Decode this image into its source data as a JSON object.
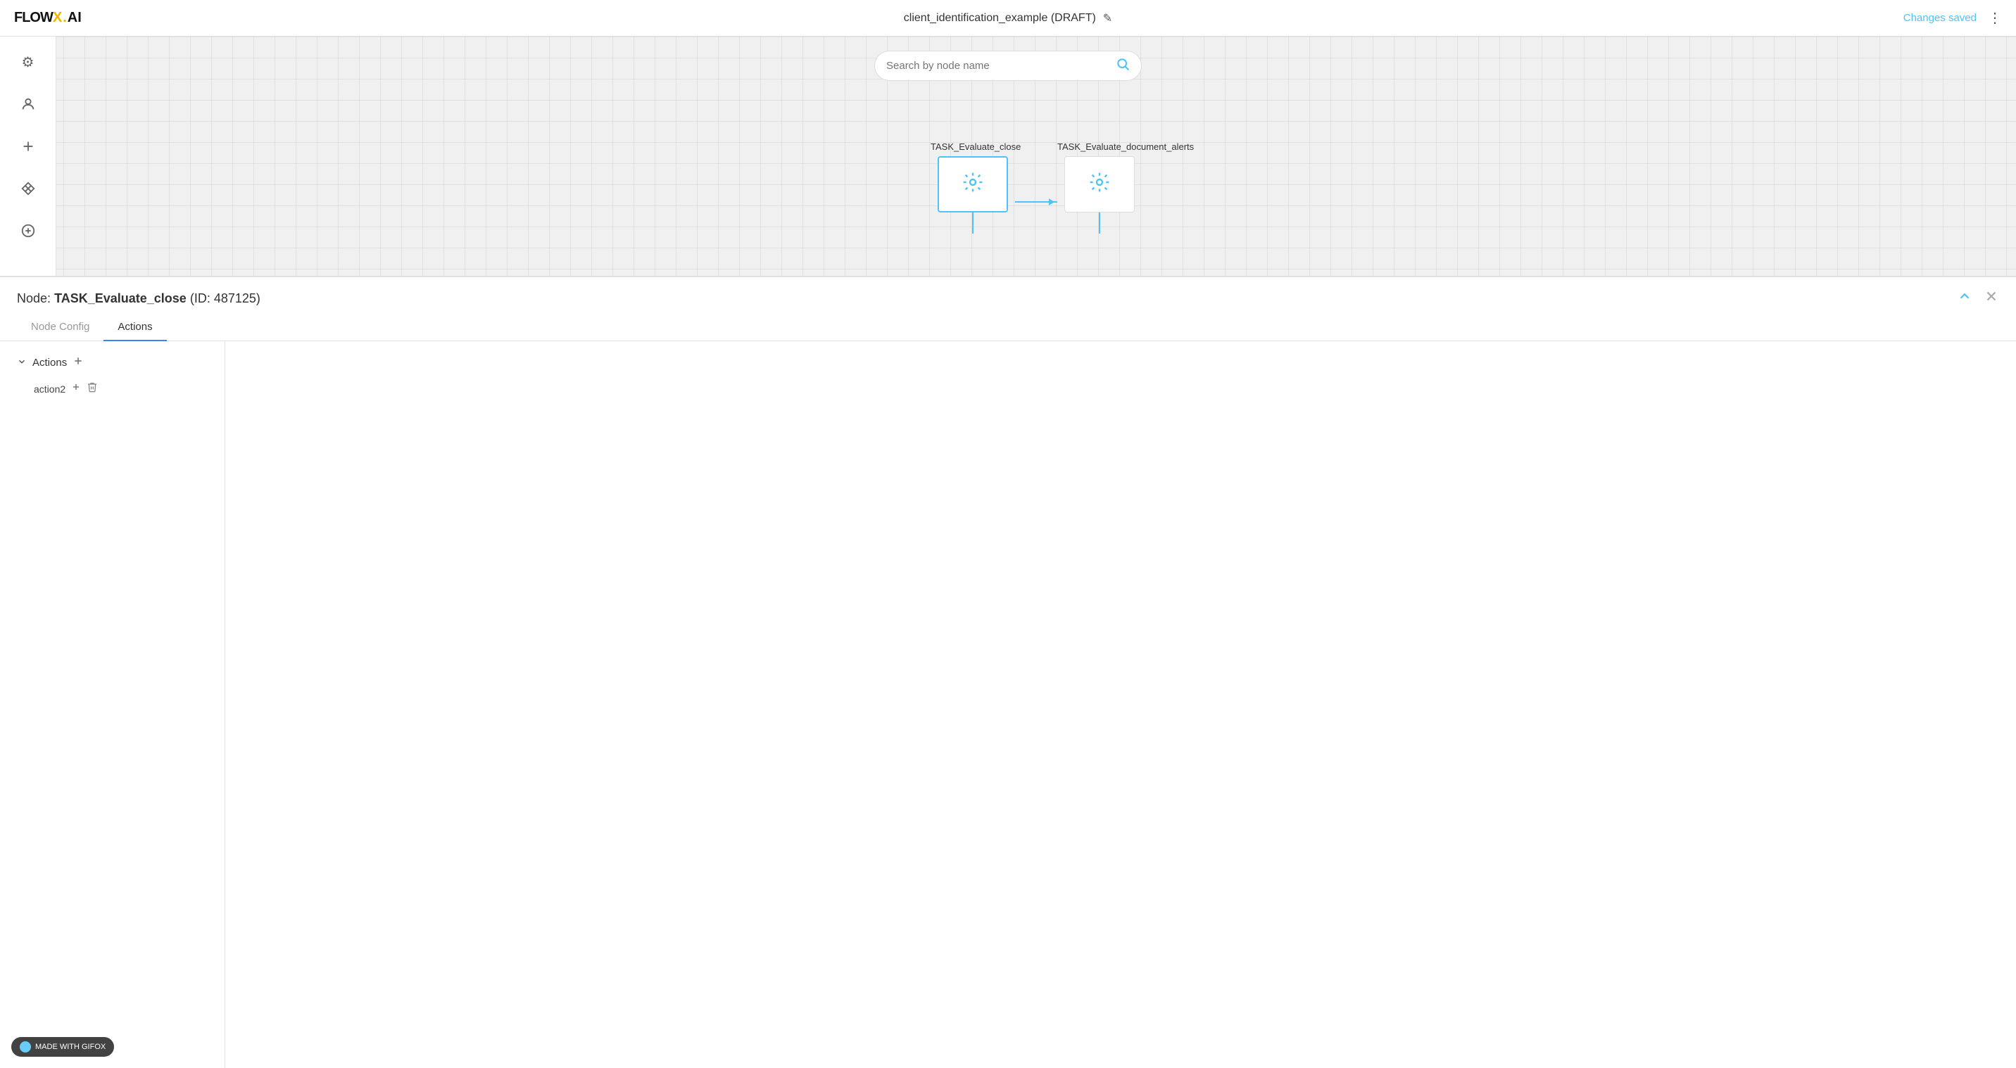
{
  "header": {
    "logo": "FLOWX.AI",
    "title": "client_identification_example (DRAFT)",
    "edit_icon": "✎",
    "changes_saved": "Changes saved",
    "more_icon": "⋮"
  },
  "search": {
    "placeholder": "Search by node name"
  },
  "sidebar": {
    "icons": [
      {
        "name": "settings-icon",
        "symbol": "⚙"
      },
      {
        "name": "person-icon",
        "symbol": "👤"
      },
      {
        "name": "add-icon",
        "symbol": "+"
      },
      {
        "name": "diamond-icon",
        "symbol": "◇"
      },
      {
        "name": "add-circle-icon",
        "symbol": "⊕"
      }
    ]
  },
  "flow": {
    "nodes": [
      {
        "id": "node-1",
        "label": "TASK_Evaluate_close",
        "selected": true
      },
      {
        "id": "node-2",
        "label": "TASK_Evaluate_document_alerts",
        "selected": false
      }
    ]
  },
  "panel": {
    "node_prefix": "Node:",
    "node_name": "TASK_Evaluate_close",
    "node_id": "(ID: 487125)",
    "collapse_icon": "∧",
    "close_icon": "×",
    "tabs": [
      {
        "id": "node-config",
        "label": "Node Config",
        "active": false
      },
      {
        "id": "actions",
        "label": "Actions",
        "active": true
      }
    ],
    "actions_section": {
      "label": "Actions",
      "items": [
        {
          "name": "action2"
        }
      ]
    }
  },
  "gifox": {
    "label": "MADE WITH GIFOX"
  }
}
